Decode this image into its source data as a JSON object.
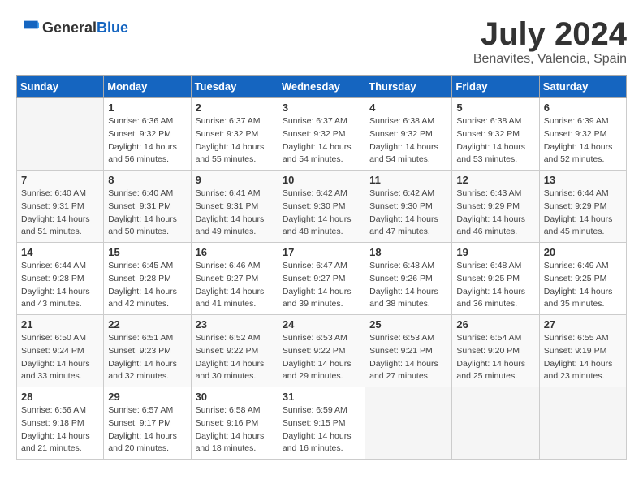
{
  "header": {
    "logo_general": "General",
    "logo_blue": "Blue",
    "month_title": "July 2024",
    "location": "Benavites, Valencia, Spain"
  },
  "calendar": {
    "days_of_week": [
      "Sunday",
      "Monday",
      "Tuesday",
      "Wednesday",
      "Thursday",
      "Friday",
      "Saturday"
    ],
    "weeks": [
      [
        {
          "day": "",
          "info": ""
        },
        {
          "day": "1",
          "info": "Sunrise: 6:36 AM\nSunset: 9:32 PM\nDaylight: 14 hours and 56 minutes."
        },
        {
          "day": "2",
          "info": "Sunrise: 6:37 AM\nSunset: 9:32 PM\nDaylight: 14 hours and 55 minutes."
        },
        {
          "day": "3",
          "info": "Sunrise: 6:37 AM\nSunset: 9:32 PM\nDaylight: 14 hours and 54 minutes."
        },
        {
          "day": "4",
          "info": "Sunrise: 6:38 AM\nSunset: 9:32 PM\nDaylight: 14 hours and 54 minutes."
        },
        {
          "day": "5",
          "info": "Sunrise: 6:38 AM\nSunset: 9:32 PM\nDaylight: 14 hours and 53 minutes."
        },
        {
          "day": "6",
          "info": "Sunrise: 6:39 AM\nSunset: 9:32 PM\nDaylight: 14 hours and 52 minutes."
        }
      ],
      [
        {
          "day": "7",
          "info": "Sunrise: 6:40 AM\nSunset: 9:31 PM\nDaylight: 14 hours and 51 minutes."
        },
        {
          "day": "8",
          "info": "Sunrise: 6:40 AM\nSunset: 9:31 PM\nDaylight: 14 hours and 50 minutes."
        },
        {
          "day": "9",
          "info": "Sunrise: 6:41 AM\nSunset: 9:31 PM\nDaylight: 14 hours and 49 minutes."
        },
        {
          "day": "10",
          "info": "Sunrise: 6:42 AM\nSunset: 9:30 PM\nDaylight: 14 hours and 48 minutes."
        },
        {
          "day": "11",
          "info": "Sunrise: 6:42 AM\nSunset: 9:30 PM\nDaylight: 14 hours and 47 minutes."
        },
        {
          "day": "12",
          "info": "Sunrise: 6:43 AM\nSunset: 9:29 PM\nDaylight: 14 hours and 46 minutes."
        },
        {
          "day": "13",
          "info": "Sunrise: 6:44 AM\nSunset: 9:29 PM\nDaylight: 14 hours and 45 minutes."
        }
      ],
      [
        {
          "day": "14",
          "info": "Sunrise: 6:44 AM\nSunset: 9:28 PM\nDaylight: 14 hours and 43 minutes."
        },
        {
          "day": "15",
          "info": "Sunrise: 6:45 AM\nSunset: 9:28 PM\nDaylight: 14 hours and 42 minutes."
        },
        {
          "day": "16",
          "info": "Sunrise: 6:46 AM\nSunset: 9:27 PM\nDaylight: 14 hours and 41 minutes."
        },
        {
          "day": "17",
          "info": "Sunrise: 6:47 AM\nSunset: 9:27 PM\nDaylight: 14 hours and 39 minutes."
        },
        {
          "day": "18",
          "info": "Sunrise: 6:48 AM\nSunset: 9:26 PM\nDaylight: 14 hours and 38 minutes."
        },
        {
          "day": "19",
          "info": "Sunrise: 6:48 AM\nSunset: 9:25 PM\nDaylight: 14 hours and 36 minutes."
        },
        {
          "day": "20",
          "info": "Sunrise: 6:49 AM\nSunset: 9:25 PM\nDaylight: 14 hours and 35 minutes."
        }
      ],
      [
        {
          "day": "21",
          "info": "Sunrise: 6:50 AM\nSunset: 9:24 PM\nDaylight: 14 hours and 33 minutes."
        },
        {
          "day": "22",
          "info": "Sunrise: 6:51 AM\nSunset: 9:23 PM\nDaylight: 14 hours and 32 minutes."
        },
        {
          "day": "23",
          "info": "Sunrise: 6:52 AM\nSunset: 9:22 PM\nDaylight: 14 hours and 30 minutes."
        },
        {
          "day": "24",
          "info": "Sunrise: 6:53 AM\nSunset: 9:22 PM\nDaylight: 14 hours and 29 minutes."
        },
        {
          "day": "25",
          "info": "Sunrise: 6:53 AM\nSunset: 9:21 PM\nDaylight: 14 hours and 27 minutes."
        },
        {
          "day": "26",
          "info": "Sunrise: 6:54 AM\nSunset: 9:20 PM\nDaylight: 14 hours and 25 minutes."
        },
        {
          "day": "27",
          "info": "Sunrise: 6:55 AM\nSunset: 9:19 PM\nDaylight: 14 hours and 23 minutes."
        }
      ],
      [
        {
          "day": "28",
          "info": "Sunrise: 6:56 AM\nSunset: 9:18 PM\nDaylight: 14 hours and 21 minutes."
        },
        {
          "day": "29",
          "info": "Sunrise: 6:57 AM\nSunset: 9:17 PM\nDaylight: 14 hours and 20 minutes."
        },
        {
          "day": "30",
          "info": "Sunrise: 6:58 AM\nSunset: 9:16 PM\nDaylight: 14 hours and 18 minutes."
        },
        {
          "day": "31",
          "info": "Sunrise: 6:59 AM\nSunset: 9:15 PM\nDaylight: 14 hours and 16 minutes."
        },
        {
          "day": "",
          "info": ""
        },
        {
          "day": "",
          "info": ""
        },
        {
          "day": "",
          "info": ""
        }
      ]
    ]
  }
}
